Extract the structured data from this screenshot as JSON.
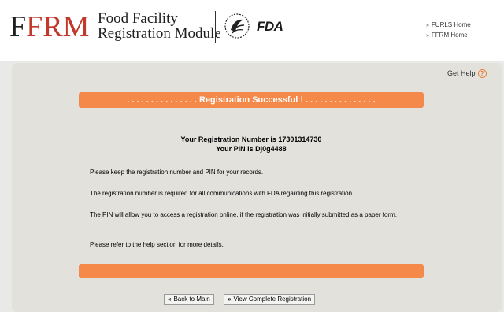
{
  "header": {
    "logo": {
      "first_letter": "F",
      "rest": "FRM"
    },
    "subtitle_line1": "Food Facility",
    "subtitle_line2": "Registration Module",
    "agency_logo_text": "FDA",
    "links": [
      {
        "label": "FURLS Home",
        "icon": "double-chevron-right-icon"
      },
      {
        "label": "FFRM Home",
        "icon": "double-chevron-right-icon"
      }
    ]
  },
  "help": {
    "label": "Get Help",
    "icon": "question-icon",
    "icon_glyph": "?"
  },
  "banner": {
    "title": ". . . . . . . . . . . . . . . Registration Successful ! . . . . . . . . . . . . . . ."
  },
  "registration": {
    "number_text": "Your Registration Number is 17301314730",
    "pin_text": "Your PIN is Dj0g4488"
  },
  "messages": [
    "Please keep the registration number and PIN for your records.",
    "The registration number is required for all communications with FDA regarding this registration.",
    "The PIN will allow you to access a registration online, if the registration was initially submitted as a paper form.",
    "Please refer to the help section for more details."
  ],
  "buttons": {
    "back": {
      "label": "Back to Main",
      "icon": "double-chevron-left-icon",
      "glyph": "«"
    },
    "view": {
      "label": "View Complete Registration",
      "icon": "double-chevron-right-icon",
      "glyph": "»"
    }
  },
  "colors": {
    "accent_orange": "#f4894a",
    "logo_red": "#c0392b",
    "panel_bg": "#e2e1dc"
  }
}
